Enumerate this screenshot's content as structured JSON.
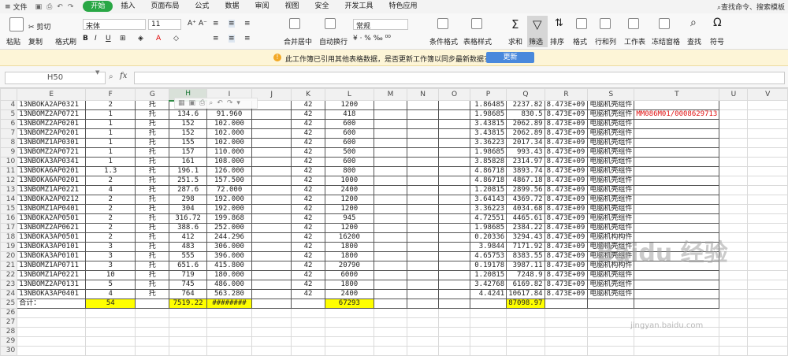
{
  "menu": {
    "file": "文件",
    "tabs": [
      "开始",
      "插入",
      "页面布局",
      "公式",
      "数据",
      "审阅",
      "视图",
      "安全",
      "开发工具",
      "特色应用"
    ],
    "active_tab": "开始",
    "search": "查找命令、搜索模板"
  },
  "ribbon": {
    "paste": "粘贴",
    "cut": "剪切",
    "copy": "复制",
    "format_painter": "格式刷",
    "font_name": "宋体",
    "font_size": "11",
    "merge": "合并居中",
    "wrap": "自动换行",
    "number_format": "常规",
    "cond_format": "条件格式",
    "table_style": "表格样式",
    "sum": "求和",
    "filter": "筛选",
    "sort": "排序",
    "format": "格式",
    "rowcol": "行和列",
    "worksheet": "工作表",
    "freeze": "冻结窗格",
    "find": "查找",
    "symbol": "符号"
  },
  "notification": {
    "text": "此工作簿已引用其他表格数据，是否更新工作簿以同步最新数据？",
    "button": "更新"
  },
  "formula_bar": {
    "name_box": "H50",
    "fx": "fx",
    "value": ""
  },
  "columns": [
    "E",
    "F",
    "G",
    "H",
    "I",
    "J",
    "K",
    "L",
    "M",
    "N",
    "O",
    "P",
    "Q",
    "R",
    "S",
    "T",
    "U",
    "V"
  ],
  "rows": [
    {
      "n": "4",
      "E": "13NBOKA2AP0321",
      "F": "2",
      "G": "托",
      "H": "",
      "I": "",
      "K": "42",
      "L": "1200",
      "P": "1.86485",
      "Q": "2237.82",
      "R": "8.473E+09",
      "S": "电脑机壳组件",
      "T": ""
    },
    {
      "n": "5",
      "E": "13NBOMZ2AP0721",
      "F": "1",
      "G": "托",
      "H": "134.6",
      "I": "91.960",
      "K": "42",
      "L": "418",
      "P": "1.98685",
      "Q": "830.5",
      "R": "8.473E+09",
      "S": "电脑机壳组件",
      "T": "MM086M01/0008629713"
    },
    {
      "n": "6",
      "E": "13NBOMZ2AP0201",
      "F": "1",
      "G": "托",
      "H": "152",
      "I": "102.000",
      "K": "42",
      "L": "600",
      "P": "3.43815",
      "Q": "2062.89",
      "R": "8.473E+09",
      "S": "电脑机壳组件",
      "T": ""
    },
    {
      "n": "7",
      "E": "13NBOMZ2AP0201",
      "F": "1",
      "G": "托",
      "H": "152",
      "I": "102.000",
      "K": "42",
      "L": "600",
      "P": "3.43815",
      "Q": "2062.89",
      "R": "8.473E+09",
      "S": "电脑机壳组件",
      "T": ""
    },
    {
      "n": "8",
      "E": "13NBOMZ1AP0301",
      "F": "1",
      "G": "托",
      "H": "155",
      "I": "102.000",
      "K": "42",
      "L": "600",
      "P": "3.36223",
      "Q": "2017.34",
      "R": "8.473E+09",
      "S": "电脑机壳组件",
      "T": ""
    },
    {
      "n": "9",
      "E": "13NBOMZ2AP0721",
      "F": "1",
      "G": "托",
      "H": "157",
      "I": "110.000",
      "K": "42",
      "L": "500",
      "P": "1.98685",
      "Q": "993.43",
      "R": "8.473E+09",
      "S": "电脑机壳组件",
      "T": ""
    },
    {
      "n": "10",
      "E": "13NBOKA3AP0341",
      "F": "1",
      "G": "托",
      "H": "161",
      "I": "108.000",
      "K": "42",
      "L": "600",
      "P": "3.85828",
      "Q": "2314.97",
      "R": "8.473E+09",
      "S": "电脑机壳组件",
      "T": ""
    },
    {
      "n": "11",
      "E": "13NBOKA6AP0201",
      "F": "1.3",
      "G": "托",
      "H": "196.1",
      "I": "126.000",
      "K": "42",
      "L": "800",
      "P": "4.86718",
      "Q": "3893.74",
      "R": "8.473E+09",
      "S": "电脑机壳组件",
      "T": ""
    },
    {
      "n": "12",
      "E": "13NBOKA6AP0201",
      "F": "2",
      "G": "托",
      "H": "251.5",
      "I": "157.500",
      "K": "42",
      "L": "1000",
      "P": "4.86718",
      "Q": "4867.18",
      "R": "8.473E+09",
      "S": "电脑机壳组件",
      "T": ""
    },
    {
      "n": "13",
      "E": "13NBOMZ1AP0221",
      "F": "4",
      "G": "托",
      "H": "287.6",
      "I": "72.000",
      "K": "42",
      "L": "2400",
      "P": "1.20815",
      "Q": "2899.56",
      "R": "8.473E+09",
      "S": "电脑机壳组件",
      "T": ""
    },
    {
      "n": "14",
      "E": "13NBOKA2AP0212",
      "F": "2",
      "G": "托",
      "H": "298",
      "I": "192.000",
      "K": "42",
      "L": "1200",
      "P": "3.64143",
      "Q": "4369.72",
      "R": "8.473E+09",
      "S": "电脑机壳组件",
      "T": ""
    },
    {
      "n": "15",
      "E": "13NBOMZ1AP0401",
      "F": "2",
      "G": "托",
      "H": "304",
      "I": "192.000",
      "K": "42",
      "L": "1200",
      "P": "3.36223",
      "Q": "4034.68",
      "R": "8.473E+09",
      "S": "电脑机壳组件",
      "T": ""
    },
    {
      "n": "16",
      "E": "13NBOKA2AP0501",
      "F": "2",
      "G": "托",
      "H": "316.72",
      "I": "199.868",
      "K": "42",
      "L": "945",
      "P": "4.72551",
      "Q": "4465.61",
      "R": "8.473E+09",
      "S": "电脑机壳组件",
      "T": ""
    },
    {
      "n": "17",
      "E": "13NBOMZ2AP0621",
      "F": "2",
      "G": "托",
      "H": "388.6",
      "I": "252.000",
      "K": "42",
      "L": "1200",
      "P": "1.98685",
      "Q": "2384.22",
      "R": "8.473E+09",
      "S": "电脑机壳组件",
      "T": ""
    },
    {
      "n": "18",
      "E": "13NBOKA3AP0501",
      "F": "2",
      "G": "托",
      "H": "412",
      "I": "244.296",
      "K": "42",
      "L": "16200",
      "P": "0.20336",
      "Q": "3294.43",
      "R": "8.473E+09",
      "S": "电脑机构构件",
      "T": ""
    },
    {
      "n": "19",
      "E": "13NBOKA3AP0101",
      "F": "3",
      "G": "托",
      "H": "483",
      "I": "306.000",
      "K": "42",
      "L": "1800",
      "P": "3.9844",
      "Q": "7171.92",
      "R": "8.473E+09",
      "S": "电脑机壳组件",
      "T": ""
    },
    {
      "n": "20",
      "E": "13NBOKA3AP0101",
      "F": "3",
      "G": "托",
      "H": "555",
      "I": "396.000",
      "K": "42",
      "L": "1800",
      "P": "4.65753",
      "Q": "8383.55",
      "R": "8.473E+09",
      "S": "电脑机壳组件",
      "T": ""
    },
    {
      "n": "21",
      "E": "13NBOMZ1AP0711",
      "F": "3",
      "G": "托",
      "H": "651.6",
      "I": "415.800",
      "K": "42",
      "L": "20790",
      "P": "0.19178",
      "Q": "3987.11",
      "R": "8.473E+09",
      "S": "电脑机构构件",
      "T": ""
    },
    {
      "n": "22",
      "E": "13NBOMZ1AP0221",
      "F": "10",
      "G": "托",
      "H": "719",
      "I": "180.000",
      "K": "42",
      "L": "6000",
      "P": "1.20815",
      "Q": "7248.9",
      "R": "8.473E+09",
      "S": "电脑机壳组件",
      "T": ""
    },
    {
      "n": "23",
      "E": "13NBOMZ2AP0131",
      "F": "5",
      "G": "托",
      "H": "745",
      "I": "486.000",
      "K": "42",
      "L": "1800",
      "P": "3.42768",
      "Q": "6169.82",
      "R": "8.473E+09",
      "S": "电脑机壳组件",
      "T": ""
    },
    {
      "n": "24",
      "E": "13NBOKA3AP0401",
      "F": "4",
      "G": "托",
      "H": "764",
      "I": "563.280",
      "K": "42",
      "L": "2400",
      "P": "4.4241",
      "Q": "10617.84",
      "R": "8.473E+09",
      "S": "电脑机壳组件",
      "T": ""
    }
  ],
  "total_row": {
    "n": "25",
    "E": "合计：",
    "F": "54",
    "H": "7519.22",
    "I": "########",
    "L": "67293",
    "Q": "87098.97"
  },
  "empty_rows": [
    "26",
    "27",
    "28",
    "29",
    "30"
  ],
  "watermark": {
    "text": "Baidu 经验",
    "url": "jingyan.baidu.com"
  }
}
